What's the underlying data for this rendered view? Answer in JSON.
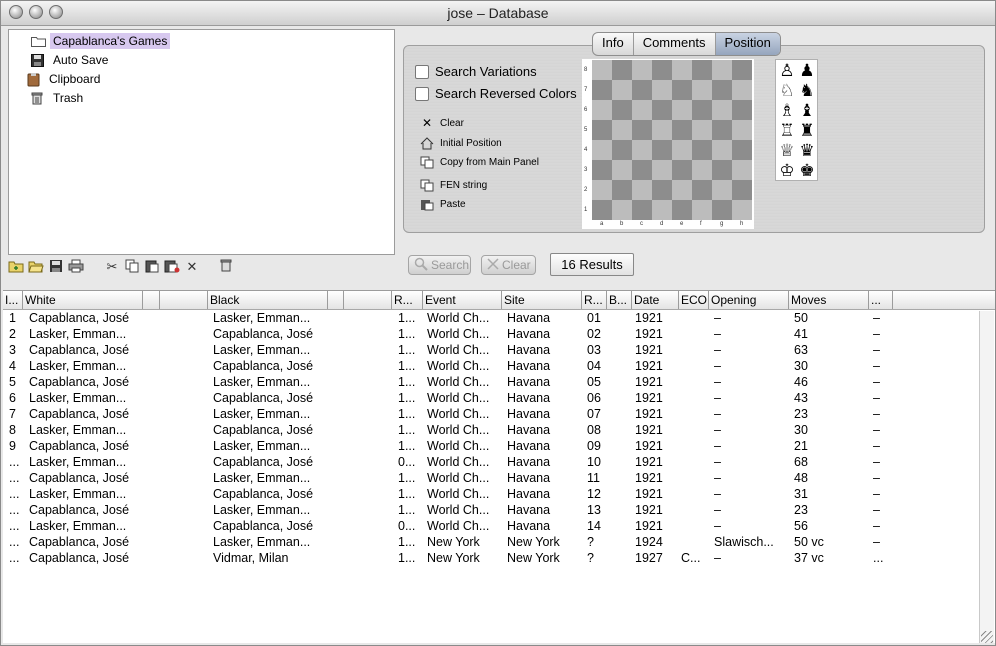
{
  "window": {
    "title": "jose – Database"
  },
  "tree": [
    {
      "label": "Capablanca's Games",
      "icon": "folder-icon",
      "selected": true
    },
    {
      "label": "Auto Save",
      "icon": "disk-icon",
      "selected": false
    },
    {
      "label": "Clipboard",
      "icon": "clipboard-icon",
      "selected": false
    },
    {
      "label": "Trash",
      "icon": "trash-icon",
      "selected": false
    }
  ],
  "toolbar": [
    "new-folder-icon",
    "open-icon",
    "save-icon",
    "print-icon",
    "cut-icon",
    "copy-icon",
    "paste-icon",
    "paste-special-icon",
    "delete-icon",
    "trash-icon"
  ],
  "tabs": [
    {
      "label": "Info",
      "active": false
    },
    {
      "label": "Comments",
      "active": false
    },
    {
      "label": "Position",
      "active": true
    }
  ],
  "options": {
    "search_variations": "Search Variations",
    "search_reversed_colors": "Search Reversed Colors"
  },
  "actions": {
    "clear": "Clear",
    "initial_position": "Initial Position",
    "copy_from_main": "Copy from Main Panel",
    "fen_string": "FEN string",
    "paste": "Paste"
  },
  "board": {
    "ranks": [
      "8",
      "7",
      "6",
      "5",
      "4",
      "3",
      "2",
      "1"
    ],
    "files": [
      "a",
      "b",
      "c",
      "d",
      "e",
      "f",
      "g",
      "h"
    ]
  },
  "pieces": [
    "♙",
    "♟",
    "♘",
    "♞",
    "♗",
    "♝",
    "♖",
    "♜",
    "♕",
    "♛",
    "♔",
    "♚"
  ],
  "buttons": {
    "search": "Search",
    "clear": "Clear"
  },
  "results": "16 Results",
  "table": {
    "headers": [
      "I...",
      "White",
      "",
      "",
      "Black",
      "",
      "",
      "R...",
      "Event",
      "Site",
      "R...",
      "B...",
      "Date",
      "ECO",
      "Opening",
      "Moves",
      "..."
    ],
    "rows": [
      [
        "1",
        "Capablanca, José",
        "Lasker, Emman...",
        "1...",
        "World Ch...",
        "Havana",
        "01",
        "",
        "1921",
        "",
        "–",
        "50",
        "–"
      ],
      [
        "2",
        "Lasker, Emman...",
        "Capablanca, José",
        "1...",
        "World Ch...",
        "Havana",
        "02",
        "",
        "1921",
        "",
        "–",
        "41",
        "–"
      ],
      [
        "3",
        "Capablanca, José",
        "Lasker, Emman...",
        "1...",
        "World Ch...",
        "Havana",
        "03",
        "",
        "1921",
        "",
        "–",
        "63",
        "–"
      ],
      [
        "4",
        "Lasker, Emman...",
        "Capablanca, José",
        "1...",
        "World Ch...",
        "Havana",
        "04",
        "",
        "1921",
        "",
        "–",
        "30",
        "–"
      ],
      [
        "5",
        "Capablanca, José",
        "Lasker, Emman...",
        "1...",
        "World Ch...",
        "Havana",
        "05",
        "",
        "1921",
        "",
        "–",
        "46",
        "–"
      ],
      [
        "6",
        "Lasker, Emman...",
        "Capablanca, José",
        "1...",
        "World Ch...",
        "Havana",
        "06",
        "",
        "1921",
        "",
        "–",
        "43",
        "–"
      ],
      [
        "7",
        "Capablanca, José",
        "Lasker, Emman...",
        "1...",
        "World Ch...",
        "Havana",
        "07",
        "",
        "1921",
        "",
        "–",
        "23",
        "–"
      ],
      [
        "8",
        "Lasker, Emman...",
        "Capablanca, José",
        "1...",
        "World Ch...",
        "Havana",
        "08",
        "",
        "1921",
        "",
        "–",
        "30",
        "–"
      ],
      [
        "9",
        "Capablanca, José",
        "Lasker, Emman...",
        "1...",
        "World Ch...",
        "Havana",
        "09",
        "",
        "1921",
        "",
        "–",
        "21",
        "–"
      ],
      [
        "...",
        "Lasker, Emman...",
        "Capablanca, José",
        "0...",
        "World Ch...",
        "Havana",
        "10",
        "",
        "1921",
        "",
        "–",
        "68",
        "–"
      ],
      [
        "...",
        "Capablanca, José",
        "Lasker, Emman...",
        "1...",
        "World Ch...",
        "Havana",
        "11",
        "",
        "1921",
        "",
        "–",
        "48",
        "–"
      ],
      [
        "...",
        "Lasker, Emman...",
        "Capablanca, José",
        "1...",
        "World Ch...",
        "Havana",
        "12",
        "",
        "1921",
        "",
        "–",
        "31",
        "–"
      ],
      [
        "...",
        "Capablanca, José",
        "Lasker, Emman...",
        "1...",
        "World Ch...",
        "Havana",
        "13",
        "",
        "1921",
        "",
        "–",
        "23",
        "–"
      ],
      [
        "...",
        "Lasker, Emman...",
        "Capablanca, José",
        "0...",
        "World Ch...",
        "Havana",
        "14",
        "",
        "1921",
        "",
        "–",
        "56",
        "–"
      ],
      [
        "...",
        "Capablanca, José",
        "Lasker, Emman...",
        "1...",
        "New York",
        "New York",
        "?",
        "",
        "1924",
        "",
        "Slawisch...",
        "50 vc",
        "–"
      ],
      [
        "...",
        "Capablanca, José",
        "Vidmar, Milan",
        "1...",
        "New York",
        "New York",
        "?",
        "",
        "1927",
        "C...",
        "–",
        "37 vc",
        "..."
      ]
    ]
  }
}
